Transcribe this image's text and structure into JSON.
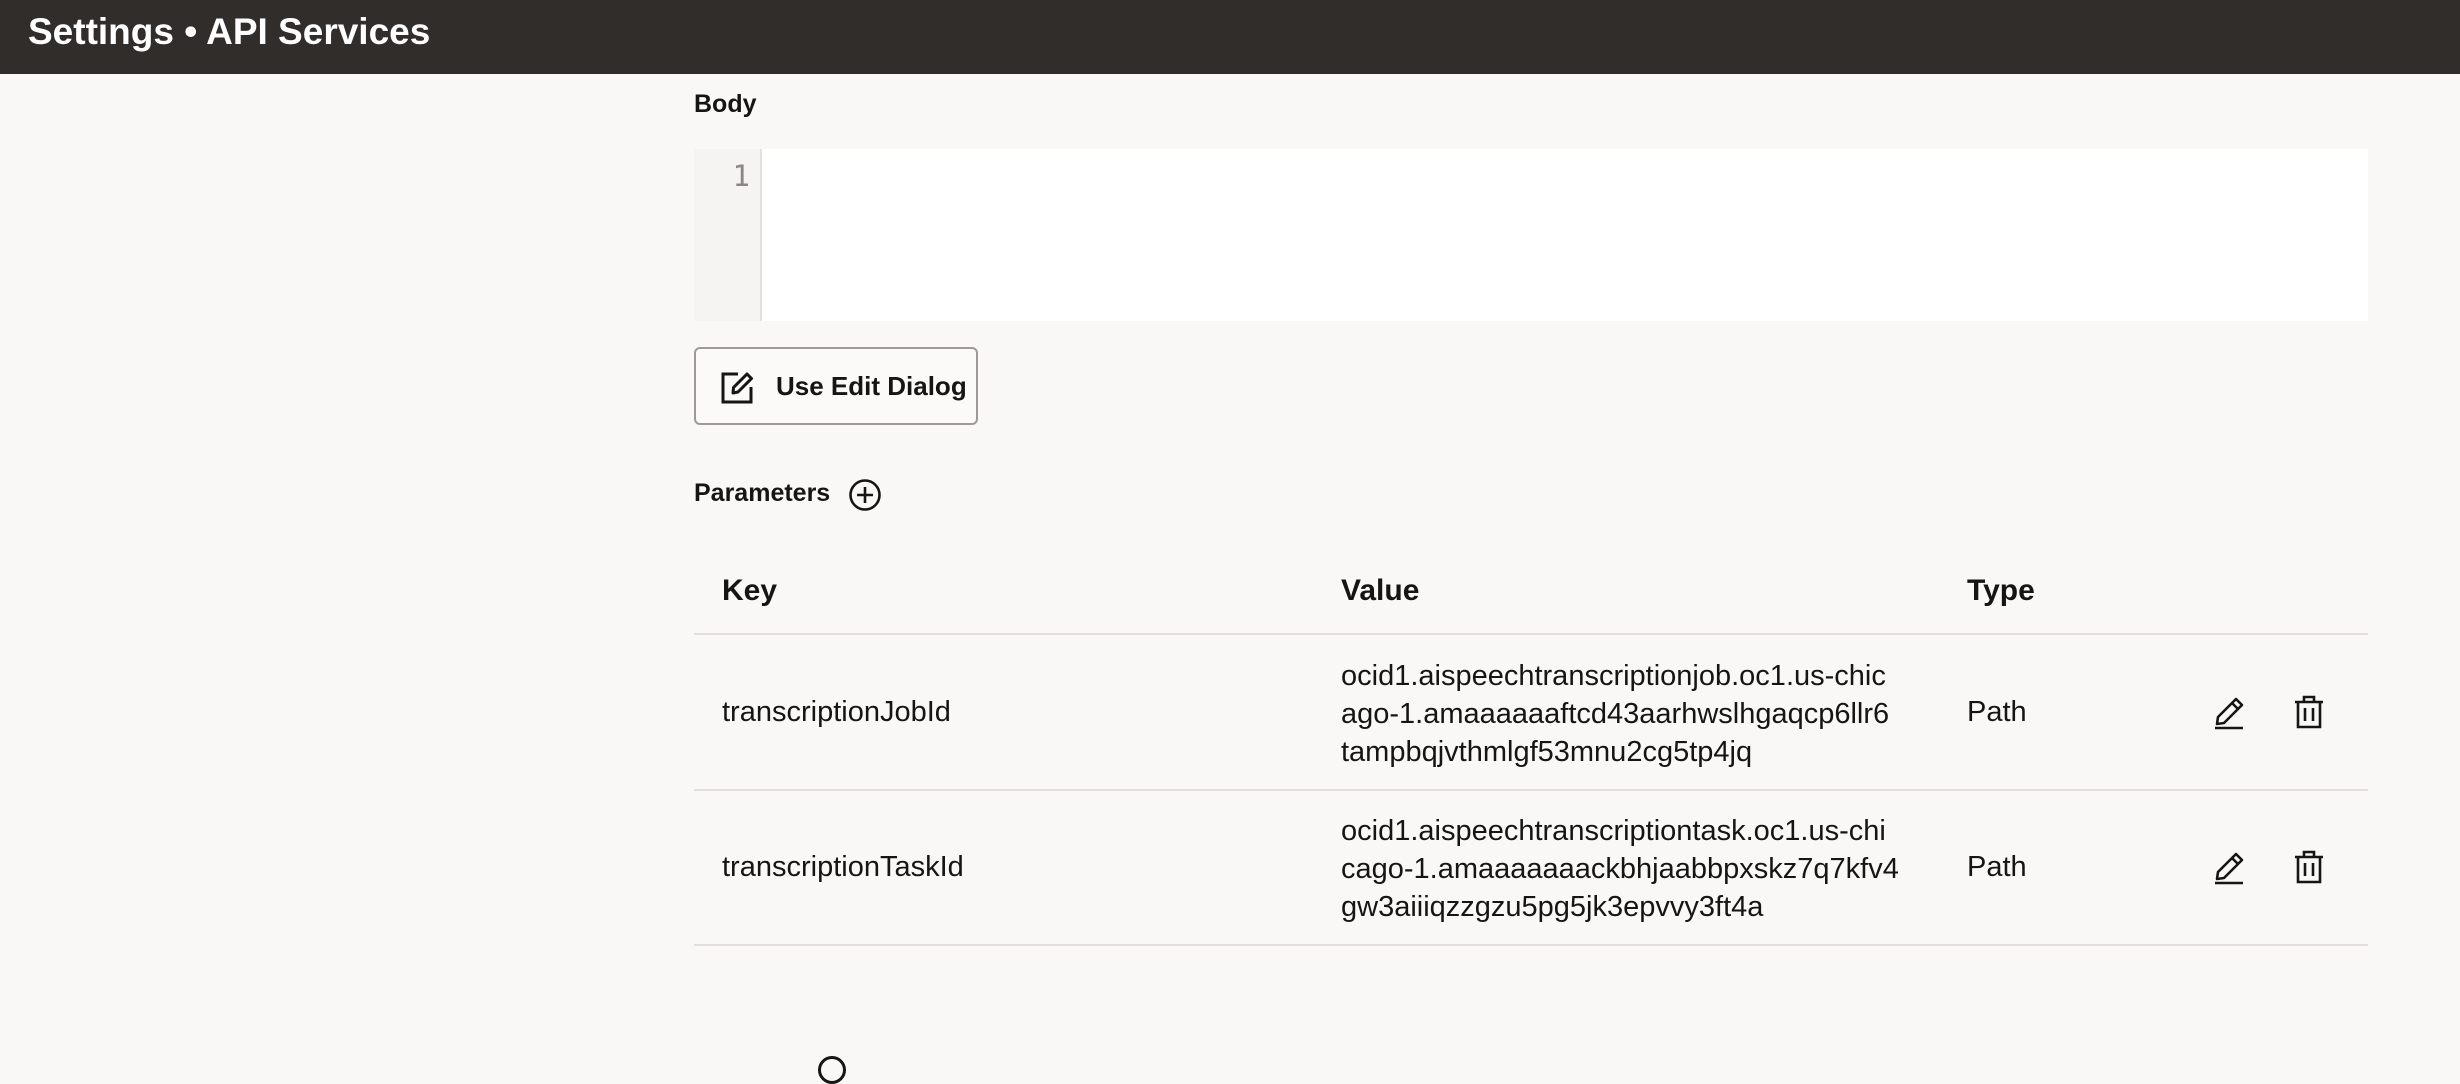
{
  "header": {
    "title": "Settings • API Services"
  },
  "body_section": {
    "label": "Body",
    "editor_line_number": "1"
  },
  "edit_dialog_button": {
    "label": "Use Edit Dialog"
  },
  "parameters": {
    "label": "Parameters",
    "columns": {
      "key": "Key",
      "value": "Value",
      "type": "Type"
    },
    "rows": [
      {
        "key": "transcriptionJobId",
        "value_lines": [
          "ocid1.aispeechtranscriptionjob.oc1.us-chic",
          "ago-1.amaaaaaaftcd43aarhwslhgaqcp6llr6",
          "tampbqjvthmlgf53mnu2cg5tp4jq"
        ],
        "type": "Path"
      },
      {
        "key": "transcriptionTaskId",
        "value_lines": [
          "ocid1.aispeechtranscriptiontask.oc1.us-chi",
          "cago-1.amaaaaaaackbhjaabbpxskz7q7kfv4",
          "gw3aiiiqzzgzu5pg5jk3epvvy3ft4a"
        ],
        "type": "Path"
      }
    ]
  }
}
